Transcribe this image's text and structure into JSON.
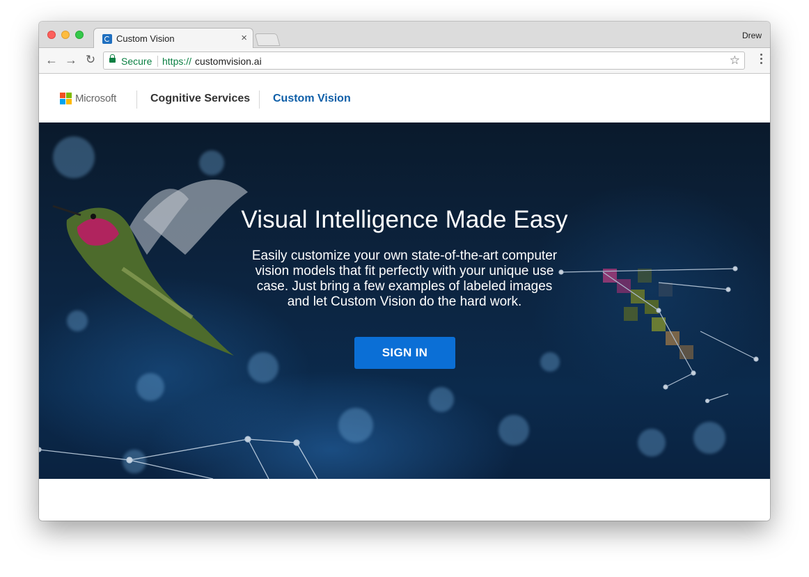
{
  "browser": {
    "tab_title": "Custom Vision",
    "tab_close": "×",
    "profile_name": "Drew",
    "secure_label": "Secure",
    "url_scheme": "https://",
    "url_host": "customvision.ai",
    "icons": {
      "back": "←",
      "forward": "→",
      "reload": "↻",
      "bookmark": "☆"
    }
  },
  "site_header": {
    "brand": "Microsoft",
    "section": "Cognitive Services",
    "product": "Custom Vision",
    "colors": {
      "product_link": "#0f5fa8",
      "ms_red": "#f25022",
      "ms_green": "#7fba00",
      "ms_blue": "#00a4ef",
      "ms_yellow": "#ffb900"
    }
  },
  "hero": {
    "title": "Visual Intelligence Made Easy",
    "description": "Easily customize your own state-of-the-art computer vision models that fit perfectly with your unique use case. Just bring a few examples of labeled images and let Custom Vision do the hard work.",
    "cta_label": "SIGN IN",
    "cta_color": "#0b6fd6"
  }
}
